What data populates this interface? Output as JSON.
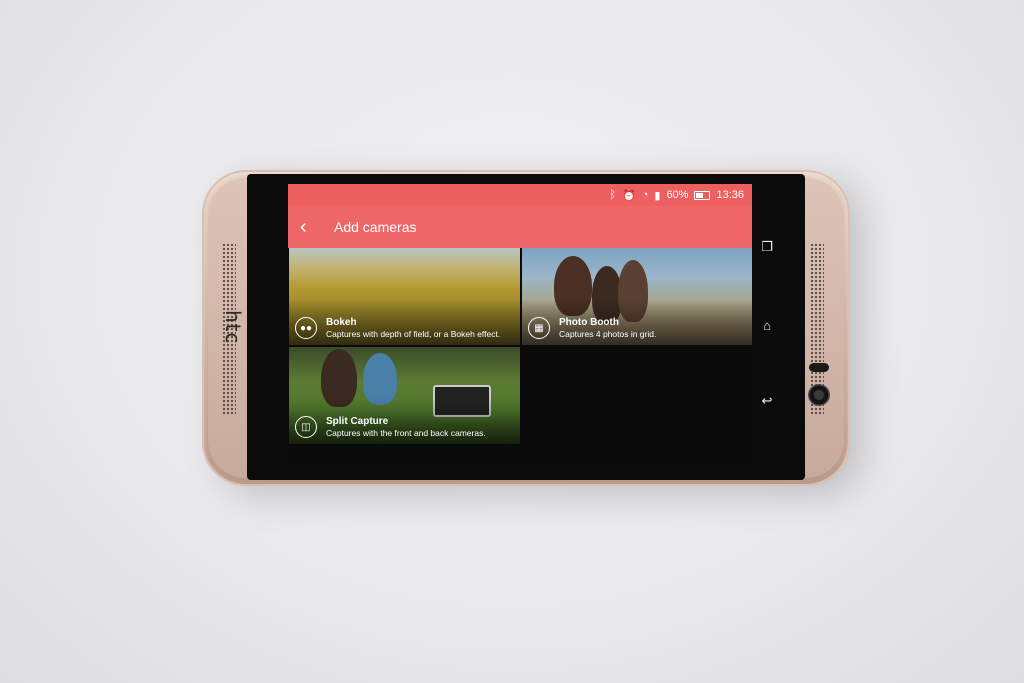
{
  "device": {
    "brand_logo": "htc"
  },
  "status_bar": {
    "icons": [
      "bluetooth-icon",
      "alarm-icon",
      "wifi-icon",
      "signal-icon",
      "battery-icon"
    ],
    "battery": "60%",
    "time": "13:36"
  },
  "app_bar": {
    "back_icon": "back-arrow-icon",
    "title": "Add cameras"
  },
  "camera_modes": [
    {
      "title": "Bokeh",
      "description": "Captures with depth of field, or a Bokeh effect.",
      "icon": "bokeh-icon"
    },
    {
      "title": "Photo Booth",
      "description": "Captures 4 photos in grid.",
      "icon": "photo-booth-icon"
    },
    {
      "title": "Split Capture",
      "description": "Captures with the front and back cameras.",
      "icon": "split-capture-icon"
    }
  ],
  "nav_buttons": [
    "recent-apps-icon",
    "home-icon",
    "back-icon"
  ],
  "colors": {
    "accent": "#ee6768",
    "status_bar": "#ee5f60"
  }
}
